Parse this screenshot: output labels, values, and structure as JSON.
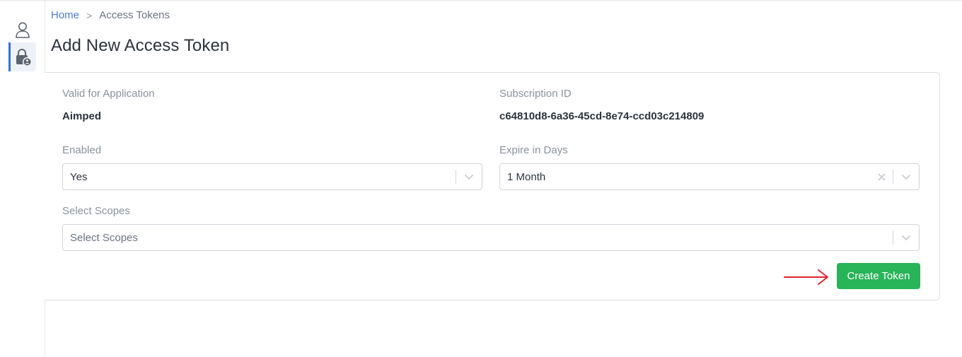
{
  "breadcrumb": {
    "home": "Home",
    "separator": ">",
    "current": "Access Tokens"
  },
  "page": {
    "title": "Add New Access Token"
  },
  "sidebar": {
    "items": [
      {
        "icon": "user-icon",
        "active": false
      },
      {
        "icon": "lock-user-icon",
        "active": true
      }
    ],
    "accent_color": "#3b6fd8"
  },
  "form": {
    "application": {
      "label": "Valid for Application",
      "value": "Aimped"
    },
    "subscription": {
      "label": "Subscription ID",
      "value": "c64810d8-6a36-45cd-8e74-ccd03c214809"
    },
    "enabled": {
      "label": "Enabled",
      "value": "Yes"
    },
    "expire": {
      "label": "Expire in Days",
      "value": "1 Month",
      "clearable": true
    },
    "scopes": {
      "label": "Select Scopes",
      "placeholder": "Select Scopes"
    },
    "submit_label": "Create Token"
  },
  "annotation": {
    "arrow_color": "#e0242b",
    "points_to": "create-token-button"
  },
  "colors": {
    "primary_button": "#28b458",
    "link": "#4a7bd4"
  }
}
